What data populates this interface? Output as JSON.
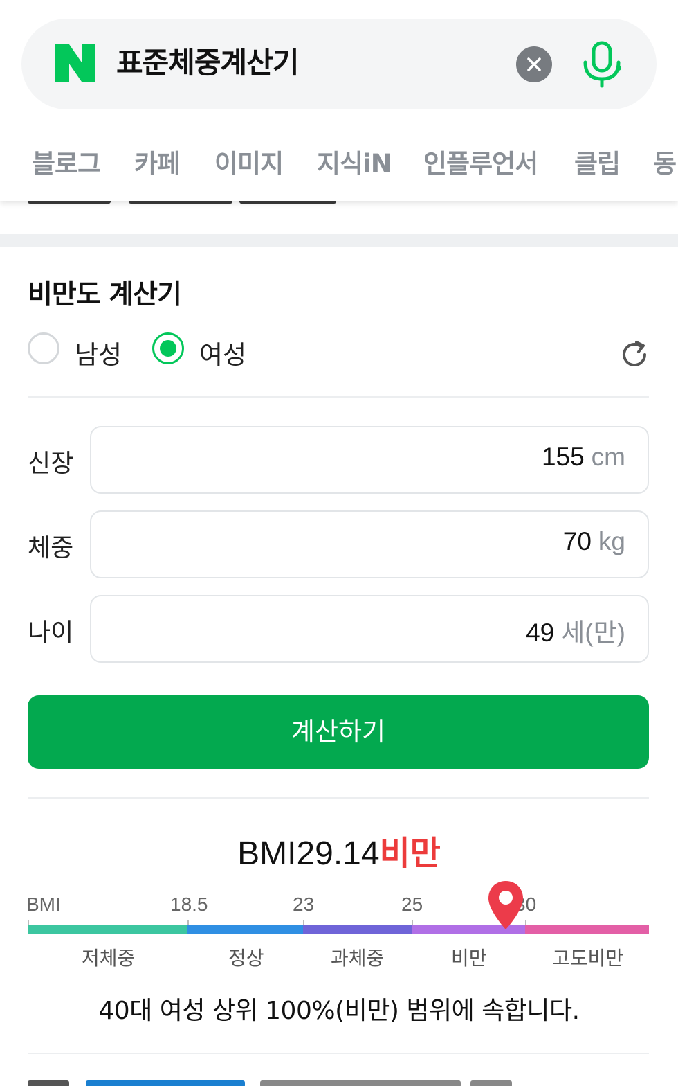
{
  "search": {
    "query": "표준체중계산기",
    "logo_icon": "naver-n-logo",
    "brand_color": "#03c75a"
  },
  "tabs": [
    "블로그",
    "카페",
    "이미지",
    "지식iN",
    "인플루언서",
    "클립",
    "동"
  ],
  "calculator": {
    "title": "비만도 계산기",
    "gender_options": [
      {
        "label": "남성",
        "checked": false
      },
      {
        "label": "여성",
        "checked": true
      }
    ],
    "fields": {
      "height": {
        "label": "신장",
        "value": "155",
        "unit": "cm"
      },
      "weight": {
        "label": "체중",
        "value": "70",
        "unit": "kg"
      },
      "age": {
        "label": "나이",
        "value": "49",
        "unit": "세(만)"
      }
    },
    "button_label": "계산하기"
  },
  "result": {
    "bmi_prefix": "BMI",
    "bmi_value": "29.14",
    "bmi_status": "비만",
    "status_color": "#ec3b3b",
    "scale": {
      "axis_label": "BMI",
      "ticks": [
        "18.5",
        "23",
        "25",
        "30"
      ],
      "categories": [
        "저체중",
        "정상",
        "과체중",
        "비만",
        "고도비만"
      ],
      "category_colors": [
        "#3cc6a0",
        "#2f8fe3",
        "#6f64d8",
        "#b06fe6",
        "#e35fa6"
      ],
      "marker_value": 29.14
    },
    "summary": "40대 여성 상위 100%(비만) 범위에 속합니다."
  }
}
